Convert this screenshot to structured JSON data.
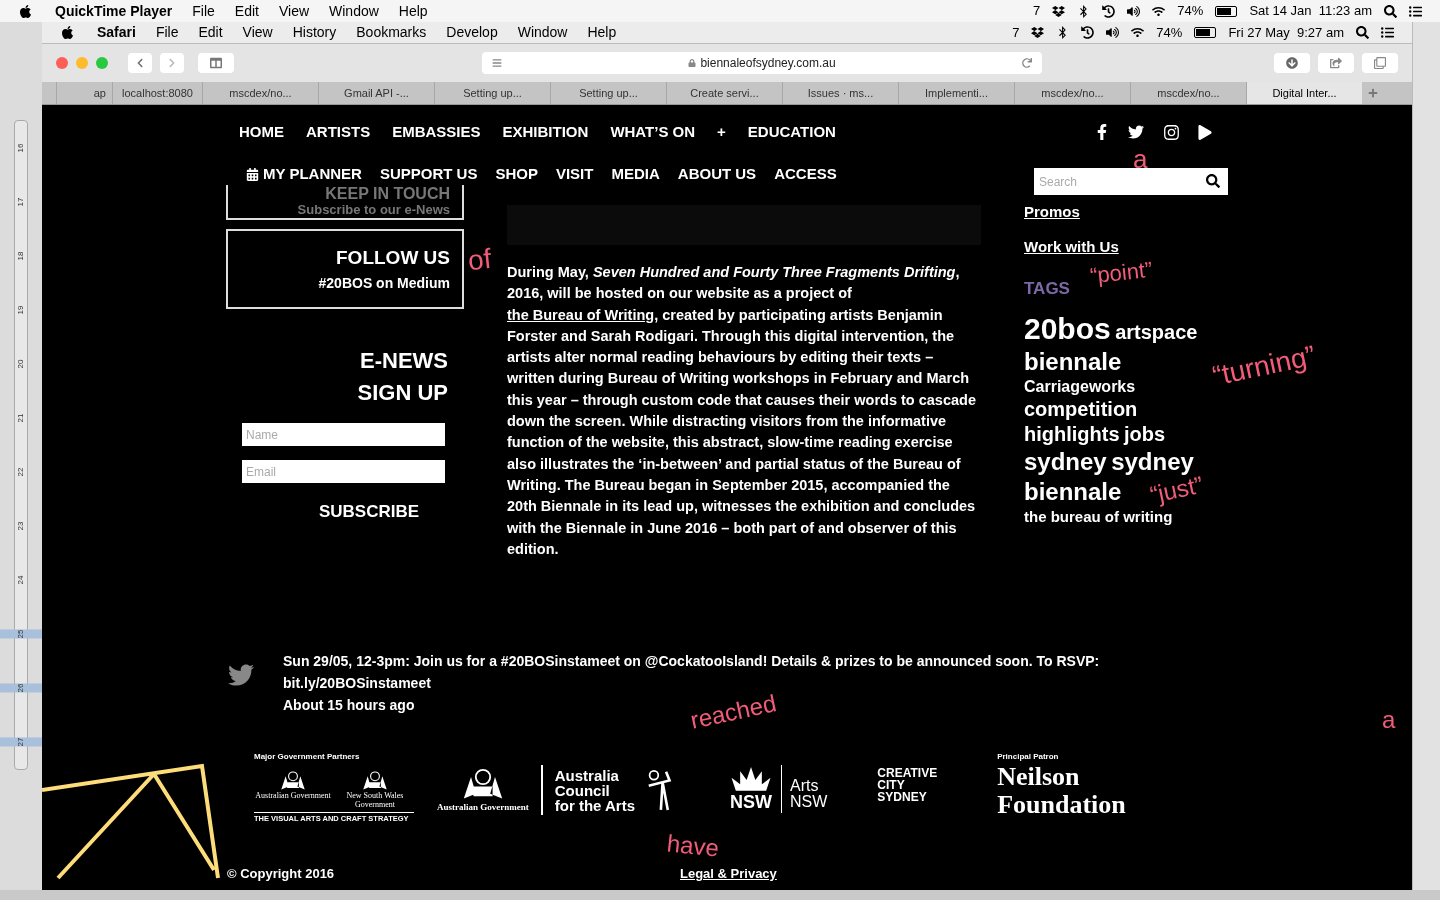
{
  "mac_menubar": {
    "app": "QuickTime Player",
    "menus": [
      "File",
      "Edit",
      "View",
      "Window",
      "Help"
    ],
    "status": [
      "7",
      "74%"
    ],
    "clock": "Sat 14 Jan  11:23 am"
  },
  "safari_menubar": {
    "app": "Safari",
    "menus": [
      "File",
      "Edit",
      "View",
      "History",
      "Bookmarks",
      "Develop",
      "Window",
      "Help"
    ],
    "status": [
      "7",
      "74%"
    ],
    "clock": "Fri 27 May  9:27 am"
  },
  "toolbar": {
    "url": "biennaleofsydney.com.au"
  },
  "tabs": [
    {
      "label": "ap",
      "selected": false
    },
    {
      "label": "localhost:8080",
      "selected": false
    },
    {
      "label": "mscdex/no...",
      "selected": false
    },
    {
      "label": "Gmail API -...",
      "selected": false
    },
    {
      "label": "Setting up...",
      "selected": false
    },
    {
      "label": "Setting up...",
      "selected": false
    },
    {
      "label": "Create servi...",
      "selected": false
    },
    {
      "label": "Issues · ms...",
      "selected": false
    },
    {
      "label": "Implementi...",
      "selected": false
    },
    {
      "label": "mscdex/no...",
      "selected": false
    },
    {
      "label": "mscdex/no...",
      "selected": false
    },
    {
      "label": "Digital Inter...",
      "selected": true
    }
  ],
  "ruler": [
    "16",
    "17",
    "18",
    "19",
    "20",
    "21",
    "22",
    "23",
    "24",
    "25",
    "26",
    "27"
  ],
  "site": {
    "nav_primary": [
      "HOME",
      "ARTISTS",
      "EMBASSIES",
      "EXHIBITION",
      "WHAT’S ON",
      "+",
      "EDUCATION"
    ],
    "nav_secondary": [
      {
        "label": "MY PLANNER",
        "kind": "planner"
      },
      {
        "label": "SUPPORT US",
        "kind": "link"
      },
      {
        "label": "SHOP",
        "kind": "link"
      },
      {
        "label": "VISIT",
        "kind": "link"
      },
      {
        "label": "MEDIA",
        "kind": "link"
      },
      {
        "label": "ABOUT US",
        "kind": "link"
      },
      {
        "label": "ACCESS",
        "kind": "link"
      }
    ],
    "keep_in_touch": {
      "title": "KEEP IN TOUCH",
      "subtitle": "Subscribe to our e-News"
    },
    "follow": {
      "title": "FOLLOW US",
      "subtitle": "#20BOS on Medium"
    },
    "enews": {
      "title_lines": [
        "E-NEWS",
        "SIGN UP"
      ],
      "fields": [
        {
          "placeholder": "Name"
        },
        {
          "placeholder": "Email"
        }
      ],
      "button": "SUBSCRIBE"
    },
    "article": [
      {
        "kind": "text",
        "text": "During May, *Seven Hundred and Fourty Three Fragments Drifting*, 2016, will be hosted on our website as a project of "
      },
      {
        "kind": "link",
        "text": "the Bureau of Writing"
      },
      {
        "kind": "text",
        "text": ", created by participating artists Benjamin Forster and Sarah Rodigari. Through this digital intervention, the artists alter normal reading behaviours by editing their texts – written during Bureau of Writing workshops in February and March this year – through custom code that causes their words to cascade down the screen. While distracting visitors from the informative function of the website, this abstract, slow-time reading exercise also illustrates the ‘in-between’ and partial status of the Bureau of Writing. The Bureau began in September 2015, accompanied the 20th Biennale in its lead up, witnesses the exhibition and concludes with the Biennale in June 2016 – both part of and observer of this edition."
      }
    ],
    "search": {
      "placeholder": "Search"
    },
    "links": [
      "Promos",
      "Work with Us"
    ],
    "tags_title": "TAGS",
    "tags": [
      {
        "text": "20bos",
        "kind": "xl"
      },
      {
        "text": "artspace",
        "kind": "md"
      },
      {
        "text": "biennale",
        "kind": "lg"
      },
      {
        "text": "Carriageworks",
        "kind": "sm"
      },
      {
        "text": "competition",
        "kind": "md"
      },
      {
        "text": "highlights",
        "kind": "md"
      },
      {
        "text": "jobs",
        "kind": "md"
      },
      {
        "text": "sydney",
        "kind": "lg"
      },
      {
        "text": "sydney",
        "kind": "lg"
      },
      {
        "text": "biennale",
        "kind": "lg"
      },
      {
        "text": "the bureau of writing",
        "kind": "xs"
      }
    ],
    "tweet": {
      "text": "Sun 29/05, 12-3pm: Join us for a #20BOSinstameet on @CockatooIsland! Details & prizes to be announced soon. To RSVP: bit.ly/20BOSinstameet",
      "time": "About 15 hours ago"
    },
    "partners": {
      "major_label": "Major Government Partners",
      "crest_labels": [
        "Australian Government",
        "New South Wales Government"
      ],
      "strategy": "THE VISUAL ARTS AND CRAFT STRATEGY",
      "council_gov": "Australian Government",
      "council_lines": [
        "Australia",
        "Council",
        "for the Arts"
      ],
      "nsw": "NSW",
      "arts_lines": [
        "Arts",
        "NSW"
      ],
      "creative_lines": [
        "CREATIVE",
        "CITY",
        "SYDNEY"
      ],
      "patron_label": "Principal Patron",
      "patron_lines": [
        "Neilson",
        "Foundation"
      ]
    },
    "footer": {
      "copyright": "© Copyright 2016",
      "legal": "Legal & Privacy"
    },
    "floating_words": [
      "of",
      "a",
      "“point”",
      "“turning”",
      "“just”",
      "reached",
      "have",
      "a"
    ]
  }
}
